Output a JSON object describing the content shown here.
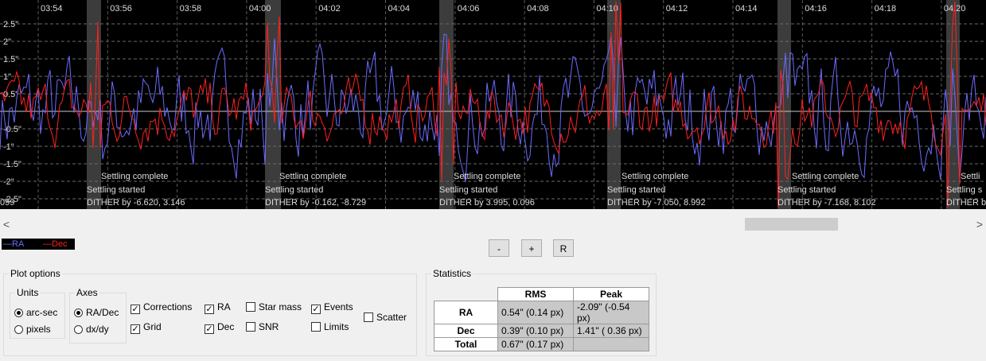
{
  "chart_data": {
    "type": "line",
    "time_ticks": [
      "03:54",
      "03:56",
      "03:58",
      "04:00",
      "04:02",
      "04:04",
      "04:06",
      "04:08",
      "04:10",
      "04:12",
      "04:14",
      "04:16",
      "04:18",
      "04:20"
    ],
    "y_ticks": [
      "2.5\"",
      "2\"",
      "1.5\"",
      "1\"",
      "0.5\"",
      "-0.5\"",
      "-1\"",
      "-1.5\"",
      "-2\"",
      "-2.5\""
    ],
    "ylim": [
      -2.9,
      3.0
    ],
    "grid": true,
    "series": [
      {
        "name": "RA",
        "color": "#6b6bff"
      },
      {
        "name": "Dec",
        "color": "#ff2020"
      }
    ],
    "events": [
      {
        "dither": "DITHER by -6.620, 3.146",
        "settling_started": "Settling started",
        "settling_complete": "Settling complete"
      },
      {
        "dither": "DITHER by -0.162, -8.729",
        "settling_started": "Settling started",
        "settling_complete": "Settling complete"
      },
      {
        "dither": "DITHER by 3.995, 0.096",
        "settling_started": "Settling started",
        "settling_complete": "Settling complete"
      },
      {
        "dither": "DITHER by -7.050, 8.992",
        "settling_started": "Settling started",
        "settling_complete": "Settling complete"
      },
      {
        "dither": "DITHER by -7.168, 8.102",
        "settling_started": "Settling started",
        "settling_complete": "Settling complete"
      },
      {
        "dither": "DITHER b",
        "settling_started": "Settling s",
        "settling_complete": "Settli"
      }
    ],
    "left_edge_text": "099"
  },
  "legend": {
    "ra": "—RA",
    "dec": "—Dec"
  },
  "zoom_buttons": {
    "minus": "-",
    "plus": "+",
    "reset": "R"
  },
  "scroll": {
    "left": "<",
    "right": ">"
  },
  "plot_options": {
    "title": "Plot options",
    "units": {
      "title": "Units",
      "arcsec": "arc-sec",
      "pixels": "pixels",
      "selected": "arc-sec"
    },
    "axes": {
      "title": "Axes",
      "radec": "RA/Dec",
      "dxdy": "dx/dy",
      "selected": "RA/Dec"
    },
    "checks": {
      "corrections": {
        "label": "Corrections",
        "checked": true
      },
      "grid": {
        "label": "Grid",
        "checked": true
      },
      "ra": {
        "label": "RA",
        "checked": true
      },
      "dec": {
        "label": "Dec",
        "checked": true
      },
      "star_mass": {
        "label": "Star mass",
        "checked": false
      },
      "snr": {
        "label": "SNR",
        "checked": false
      },
      "events": {
        "label": "Events",
        "checked": true
      },
      "limits": {
        "label": "Limits",
        "checked": false
      },
      "scatter": {
        "label": "Scatter",
        "checked": false
      }
    }
  },
  "statistics": {
    "title": "Statistics",
    "headers": [
      "RMS",
      "Peak"
    ],
    "rows": [
      {
        "label": "RA",
        "rms": "0.54\" (0.14 px)",
        "peak": "-2.09\" (-0.54 px)"
      },
      {
        "label": "Dec",
        "rms": "0.39\" (0.10 px)",
        "peak": "1.41\" ( 0.36 px)"
      },
      {
        "label": "Total",
        "rms": "0.67\" (0.17 px)",
        "peak": ""
      }
    ]
  }
}
